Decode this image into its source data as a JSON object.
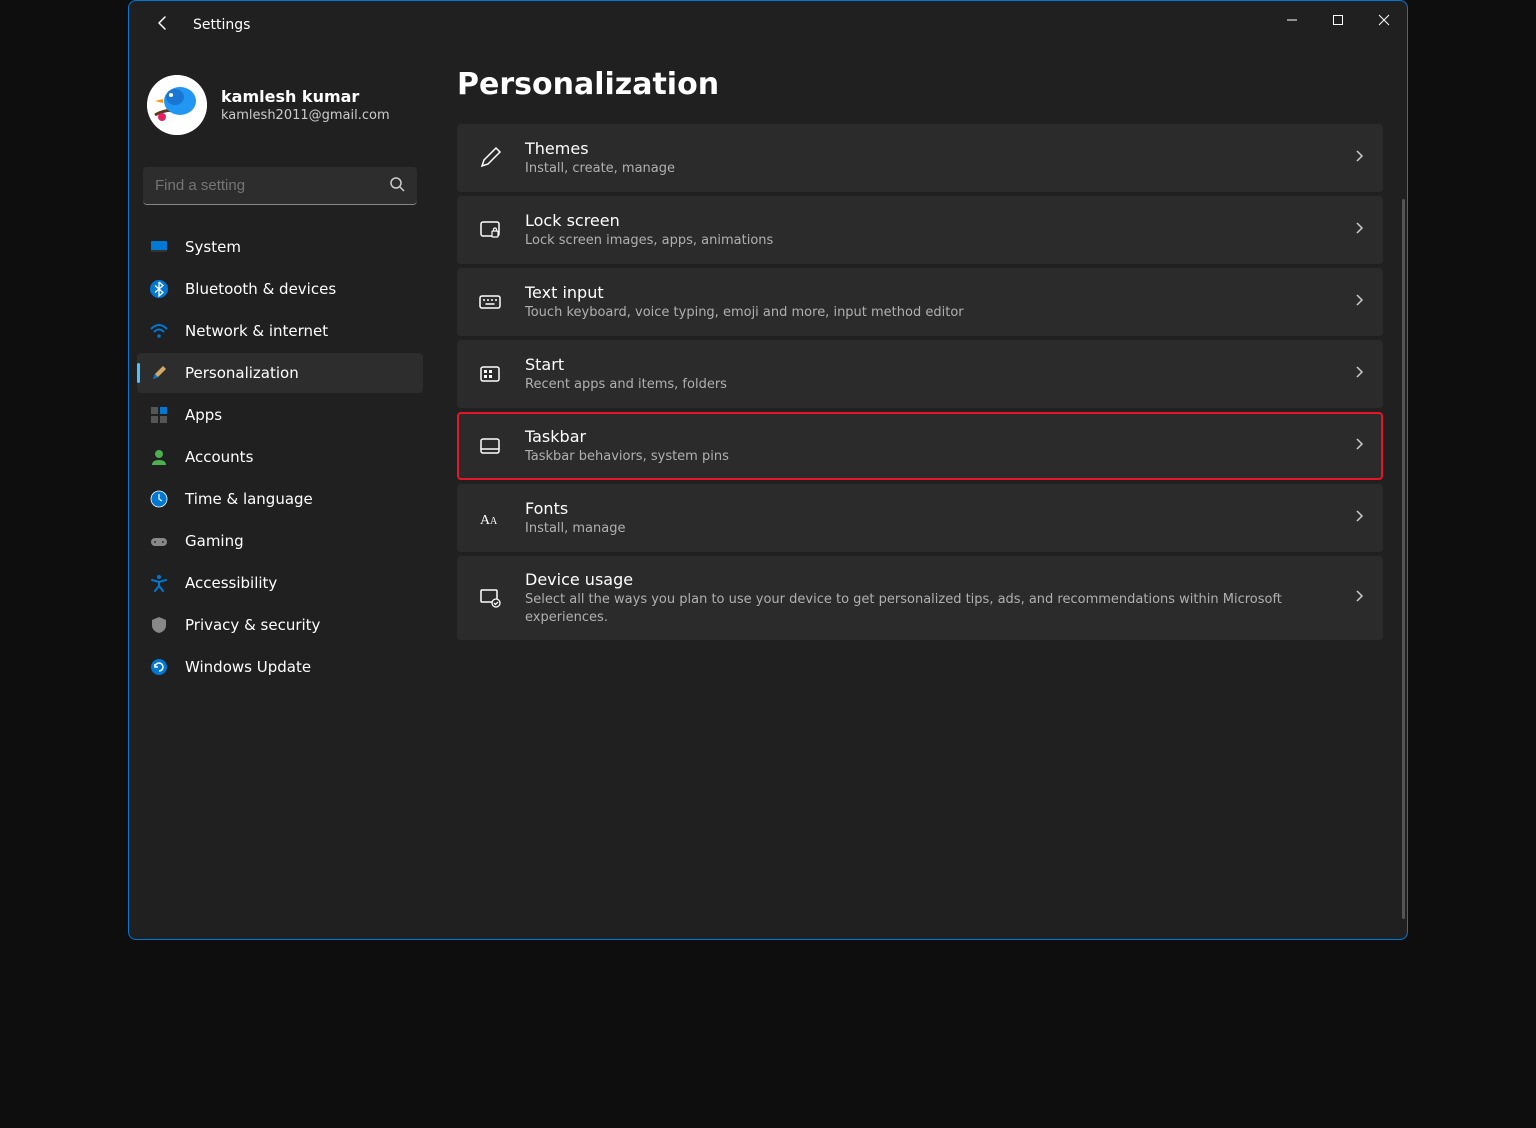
{
  "titlebar": {
    "app_title": "Settings"
  },
  "profile": {
    "name": "kamlesh kumar",
    "email": "kamlesh2011@gmail.com"
  },
  "search": {
    "placeholder": "Find a setting"
  },
  "nav": {
    "items": [
      {
        "label": "System"
      },
      {
        "label": "Bluetooth & devices"
      },
      {
        "label": "Network & internet"
      },
      {
        "label": "Personalization"
      },
      {
        "label": "Apps"
      },
      {
        "label": "Accounts"
      },
      {
        "label": "Time & language"
      },
      {
        "label": "Gaming"
      },
      {
        "label": "Accessibility"
      },
      {
        "label": "Privacy & security"
      },
      {
        "label": "Windows Update"
      }
    ],
    "active_index": 3
  },
  "page": {
    "title": "Personalization"
  },
  "cards": [
    {
      "title": "Themes",
      "sub": "Install, create, manage",
      "icon": "pen-icon"
    },
    {
      "title": "Lock screen",
      "sub": "Lock screen images, apps, animations",
      "icon": "lock-screen-icon"
    },
    {
      "title": "Text input",
      "sub": "Touch keyboard, voice typing, emoji and more, input method editor",
      "icon": "keyboard-icon"
    },
    {
      "title": "Start",
      "sub": "Recent apps and items, folders",
      "icon": "start-icon"
    },
    {
      "title": "Taskbar",
      "sub": "Taskbar behaviors, system pins",
      "icon": "taskbar-icon",
      "highlight": true
    },
    {
      "title": "Fonts",
      "sub": "Install, manage",
      "icon": "fonts-icon"
    },
    {
      "title": "Device usage",
      "sub": "Select all the ways you plan to use your device to get personalized tips, ads, and recommendations within Microsoft experiences.",
      "icon": "device-usage-icon"
    }
  ]
}
